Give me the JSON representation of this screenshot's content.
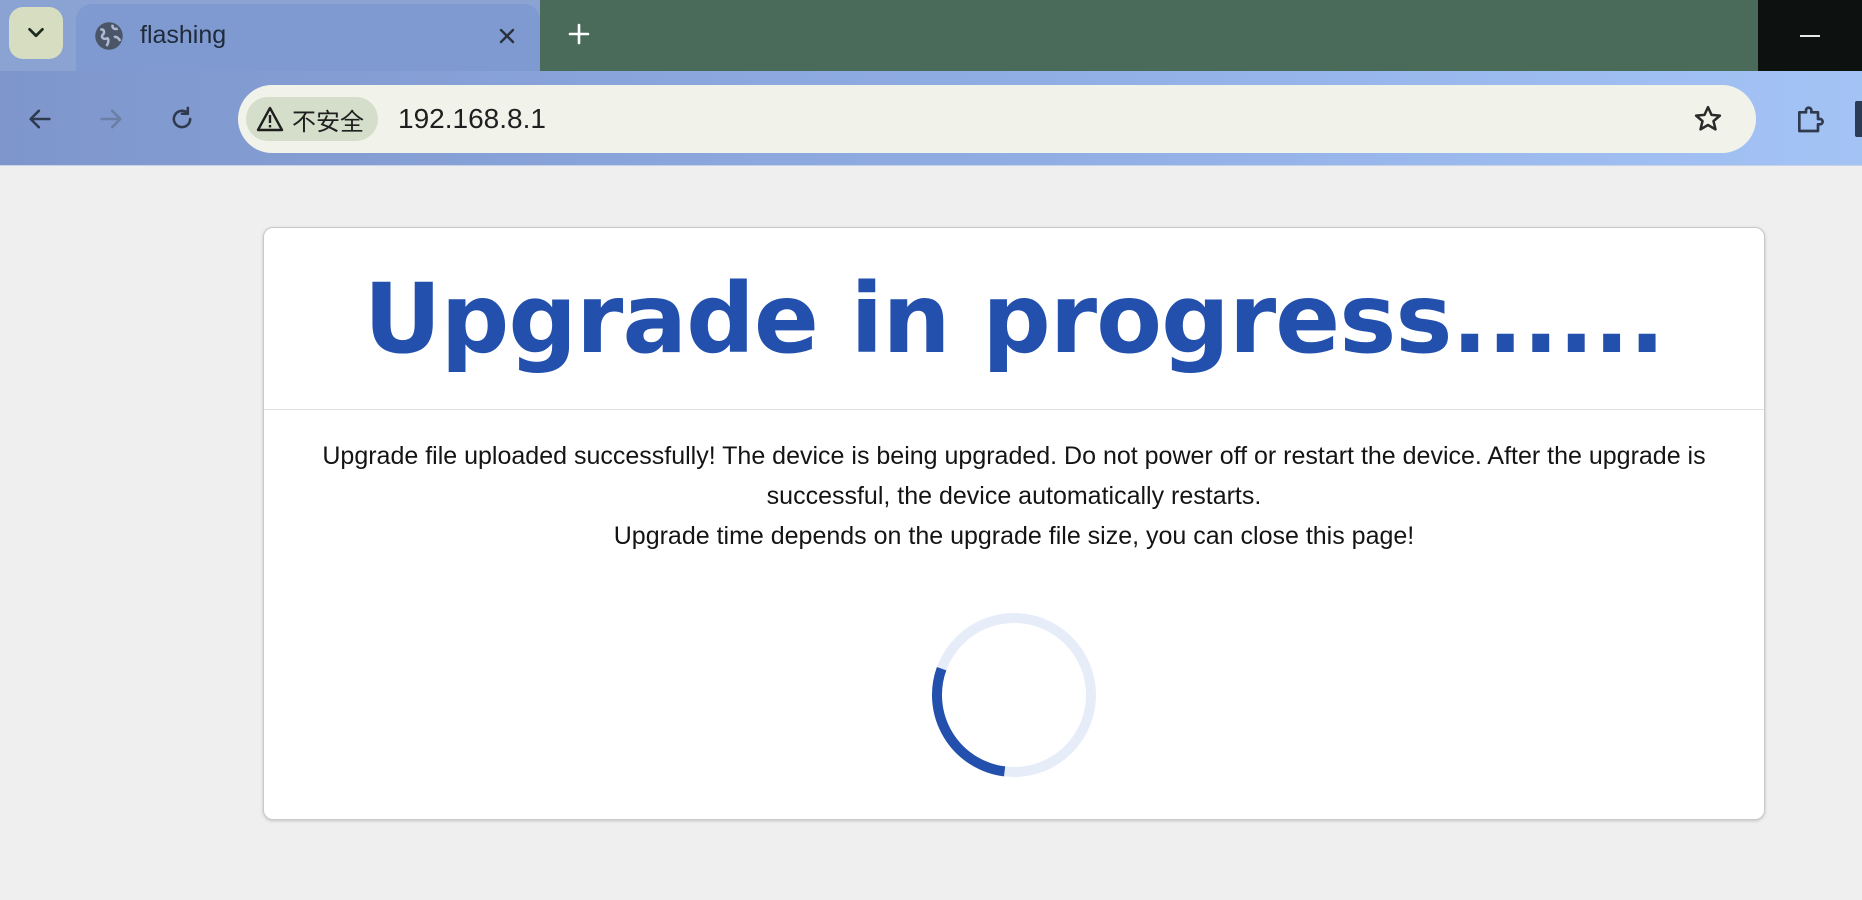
{
  "browser": {
    "tab": {
      "title": "flashing",
      "favicon": "globe-icon",
      "close_icon": "close-icon"
    },
    "new_tab_icon": "plus-icon",
    "window": {
      "minimize_icon": "minimize-icon"
    },
    "nav": {
      "back_icon": "arrow-left-icon",
      "forward_icon": "arrow-right-icon",
      "reload_icon": "reload-icon"
    },
    "omnibox": {
      "security_label": "不安全",
      "security_icon": "warning-triangle-icon",
      "url": "192.168.8.1",
      "bookmark_icon": "star-icon"
    },
    "extensions_icon": "puzzle-icon"
  },
  "page": {
    "heading": "Upgrade in progress......",
    "message_line1": "Upgrade file uploaded successfully! The device is being upgraded. Do not power off or restart the device. After the upgrade is successful, the device automatically restarts.",
    "message_line2": "Upgrade time depends on the upgrade file size, you can close this page!",
    "spinner_icon": "loading-spinner-icon"
  },
  "colors": {
    "heading": "#2350ad",
    "spinner_track": "#e6edf9",
    "spinner_arc": "#2350ad",
    "page_bg": "#efefef"
  }
}
